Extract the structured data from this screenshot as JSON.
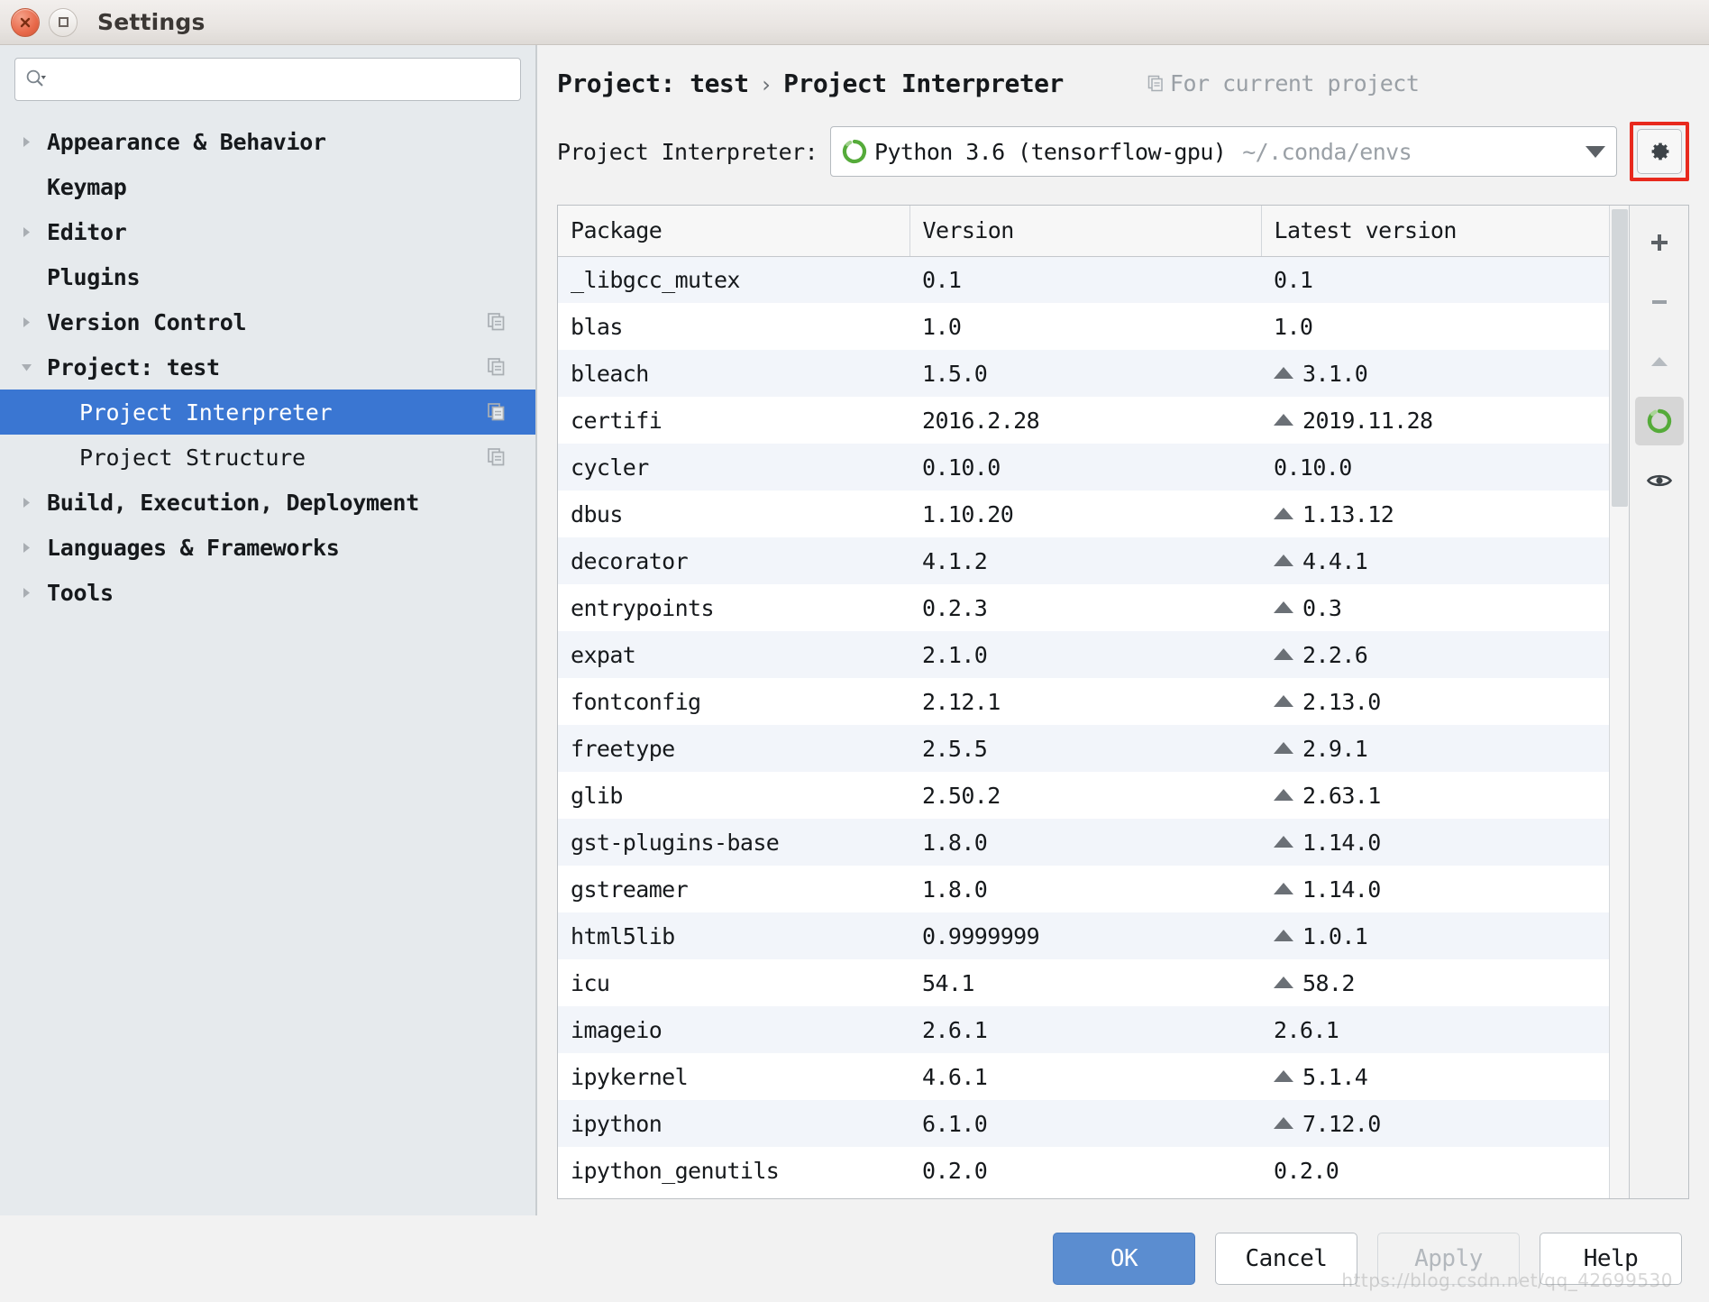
{
  "window": {
    "title": "Settings",
    "close_icon": "close-icon",
    "maximize_icon": "maximize-icon"
  },
  "search": {
    "placeholder": "",
    "value": "",
    "icon": "search-icon"
  },
  "sidebar": {
    "items": [
      {
        "label": "Appearance & Behavior",
        "level": "top",
        "expander": "collapsed",
        "copy_badge": false,
        "selected": false
      },
      {
        "label": "Keymap",
        "level": "top",
        "expander": "none",
        "copy_badge": false,
        "selected": false
      },
      {
        "label": "Editor",
        "level": "top",
        "expander": "collapsed",
        "copy_badge": false,
        "selected": false
      },
      {
        "label": "Plugins",
        "level": "top",
        "expander": "none",
        "copy_badge": false,
        "selected": false
      },
      {
        "label": "Version Control",
        "level": "top",
        "expander": "collapsed",
        "copy_badge": true,
        "selected": false
      },
      {
        "label": "Project: test",
        "level": "top",
        "expander": "expanded",
        "copy_badge": true,
        "selected": false
      },
      {
        "label": "Project Interpreter",
        "level": "child",
        "expander": "none",
        "copy_badge": true,
        "selected": true
      },
      {
        "label": "Project Structure",
        "level": "child",
        "expander": "none",
        "copy_badge": true,
        "selected": false
      },
      {
        "label": "Build, Execution, Deployment",
        "level": "top",
        "expander": "collapsed",
        "copy_badge": false,
        "selected": false
      },
      {
        "label": "Languages & Frameworks",
        "level": "top",
        "expander": "collapsed",
        "copy_badge": false,
        "selected": false
      },
      {
        "label": "Tools",
        "level": "top",
        "expander": "collapsed",
        "copy_badge": false,
        "selected": false
      }
    ]
  },
  "header": {
    "breadcrumb_parent": "Project: test",
    "breadcrumb_separator": "›",
    "breadcrumb_current": "Project Interpreter",
    "scope_note": "For current project",
    "scope_icon": "copy-icon"
  },
  "interpreter": {
    "label": "Project Interpreter:",
    "icon": "conda-env-icon",
    "name": "Python 3.6 (tensorflow-gpu)",
    "path": "~/.conda/envs",
    "caret_icon": "chevron-down-icon",
    "gear_icon": "gear-icon",
    "gear_highlight_color": "#e8291d"
  },
  "packages_table": {
    "columns": [
      "Package",
      "Version",
      "Latest version"
    ],
    "rows": [
      {
        "package": "_libgcc_mutex",
        "version": "0.1",
        "latest": "0.1",
        "upgradable": false
      },
      {
        "package": "blas",
        "version": "1.0",
        "latest": "1.0",
        "upgradable": false
      },
      {
        "package": "bleach",
        "version": "1.5.0",
        "latest": "3.1.0",
        "upgradable": true
      },
      {
        "package": "certifi",
        "version": "2016.2.28",
        "latest": "2019.11.28",
        "upgradable": true
      },
      {
        "package": "cycler",
        "version": "0.10.0",
        "latest": "0.10.0",
        "upgradable": false
      },
      {
        "package": "dbus",
        "version": "1.10.20",
        "latest": "1.13.12",
        "upgradable": true
      },
      {
        "package": "decorator",
        "version": "4.1.2",
        "latest": "4.4.1",
        "upgradable": true
      },
      {
        "package": "entrypoints",
        "version": "0.2.3",
        "latest": "0.3",
        "upgradable": true
      },
      {
        "package": "expat",
        "version": "2.1.0",
        "latest": "2.2.6",
        "upgradable": true
      },
      {
        "package": "fontconfig",
        "version": "2.12.1",
        "latest": "2.13.0",
        "upgradable": true
      },
      {
        "package": "freetype",
        "version": "2.5.5",
        "latest": "2.9.1",
        "upgradable": true
      },
      {
        "package": "glib",
        "version": "2.50.2",
        "latest": "2.63.1",
        "upgradable": true
      },
      {
        "package": "gst-plugins-base",
        "version": "1.8.0",
        "latest": "1.14.0",
        "upgradable": true
      },
      {
        "package": "gstreamer",
        "version": "1.8.0",
        "latest": "1.14.0",
        "upgradable": true
      },
      {
        "package": "html5lib",
        "version": "0.9999999",
        "latest": "1.0.1",
        "upgradable": true
      },
      {
        "package": "icu",
        "version": "54.1",
        "latest": "58.2",
        "upgradable": true
      },
      {
        "package": "imageio",
        "version": "2.6.1",
        "latest": "2.6.1",
        "upgradable": false
      },
      {
        "package": "ipykernel",
        "version": "4.6.1",
        "latest": "5.1.4",
        "upgradable": true
      },
      {
        "package": "ipython",
        "version": "6.1.0",
        "latest": "7.12.0",
        "upgradable": true
      },
      {
        "package": "ipython_genutils",
        "version": "0.2.0",
        "latest": "0.2.0",
        "upgradable": false
      }
    ]
  },
  "table_tools": [
    {
      "name": "add-package-button",
      "icon": "plus-icon"
    },
    {
      "name": "remove-package-button",
      "icon": "minus-icon"
    },
    {
      "name": "upgrade-package-button",
      "icon": "upgrade-triangle-icon"
    },
    {
      "name": "conda-refresh-button",
      "icon": "conda-env-icon",
      "active": true
    },
    {
      "name": "show-early-releases-button",
      "icon": "eye-icon"
    }
  ],
  "footer": {
    "ok": "OK",
    "cancel": "Cancel",
    "apply": "Apply",
    "help": "Help",
    "apply_disabled": true,
    "watermark": "https://blog.csdn.net/qq_42699530"
  }
}
